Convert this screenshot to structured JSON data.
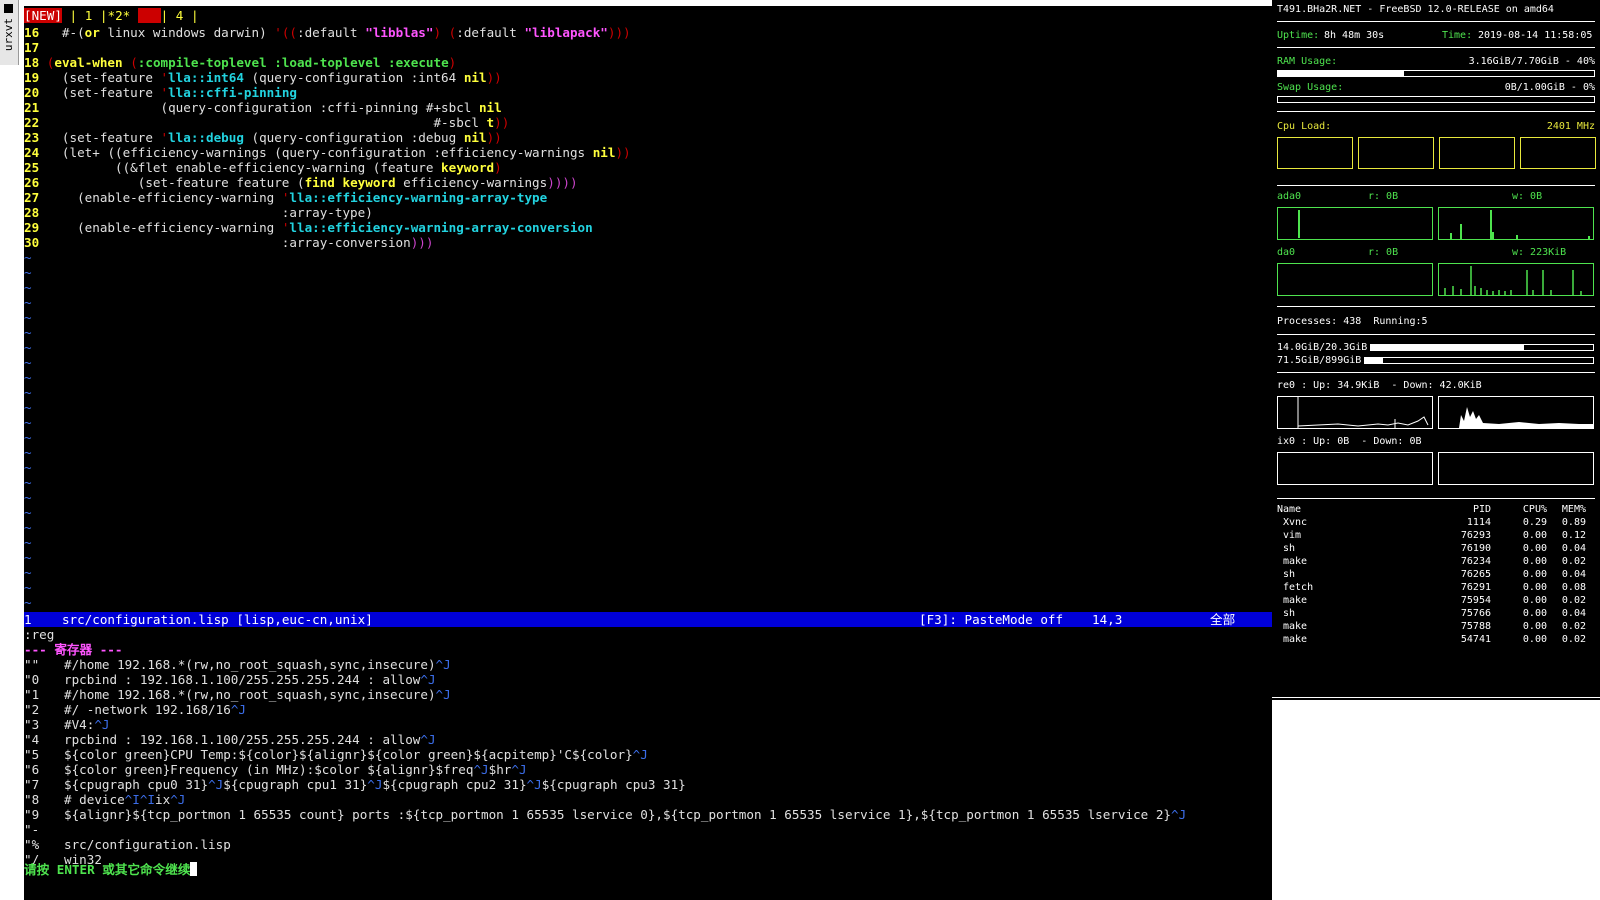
{
  "window": {
    "grip_label": "urxvt"
  },
  "tabs": {
    "new": "[NEW]",
    "t1": "1",
    "t2": "*2*",
    "t3": "3",
    "t4": "4",
    "sep": "|"
  },
  "code": [
    {
      "n": "16"
    },
    {
      "n": "17"
    },
    {
      "n": "18"
    },
    {
      "n": "19"
    },
    {
      "n": "20"
    },
    {
      "n": "21"
    },
    {
      "n": "22"
    },
    {
      "n": "23"
    },
    {
      "n": "24"
    },
    {
      "n": "25"
    },
    {
      "n": "26"
    },
    {
      "n": "27"
    },
    {
      "n": "28"
    },
    {
      "n": "29"
    },
    {
      "n": "30"
    }
  ],
  "t": {
    "l16a": "#-(",
    "l16b": "or",
    "l16c": " linux windows darwin) ",
    "l16d": "'((",
    "l16e": ":default ",
    "l16f": "\"libblas\"",
    "l16g": ") (",
    "l16h": ":default ",
    "l16i": "\"liblapack\"",
    "l16j": ")))",
    "l18a": "(",
    "l18b": "eval-when",
    "l18c": " (",
    "l18d": ":compile-toplevel :load-toplevel :execute",
    "l18e": ")",
    "l19a": "  (set-feature ",
    "l19b": "'",
    "l19c": "lla::int64",
    "l19d": " (query-configuration :int64 ",
    "l19e": "nil",
    "l19f": "))",
    "l20a": "  (set-feature ",
    "l20b": "'",
    "l20c": "lla::cffi-pinning",
    "l21a": "               (query-configuration :cffi-pinning #+sbcl ",
    "l21b": "nil",
    "l22a": "                                                   #-sbcl ",
    "l22b": "t",
    "l22c": "))",
    "l23a": "  (set-feature ",
    "l23b": "'",
    "l23c": "lla::debug",
    "l23d": " (query-configuration :debug ",
    "l23e": "nil",
    "l23f": "))",
    "l24a": "  (",
    "l24b": "let+",
    "l24c": " ((efficiency-warnings (query-configuration :efficiency-warnings ",
    "l24d": "nil",
    "l24e": "))",
    "l25a": "         ((&flet enable-efficiency-warning (feature ",
    "l25b": "keyword",
    "l25c": ")",
    "l26a": "            (set-feature feature (",
    "l26b": "find",
    "l26c": " ",
    "l26d": "keyword",
    "l26e": " efficiency-warnings",
    "l26f": "))))",
    "l27a": "    (enable-efficiency-warning ",
    "l27b": "'",
    "l27c": "lla::efficiency-warning-array-type",
    "l28a": "                               :array-type)",
    "l29a": "    (enable-efficiency-warning ",
    "l29b": "'",
    "l29c": "lla::efficiency-warning-array-conversion",
    "l30a": "                               :array-conversion",
    "l30b": ")))"
  },
  "tilde": "~",
  "statusline": {
    "buf": "1",
    "file": "src/configuration.lisp [lisp,euc-cn,unix]",
    "paste": "[F3]: PasteMode off",
    "pos": "14,3",
    "all": "全部"
  },
  "cmd": ":reg",
  "reg_header": "--- 寄存器 ---",
  "registers": [
    {
      "name": "\"\"",
      "val": "#/home 192.168.*(rw,no_root_squash,sync,insecure)",
      "ctl": "^J"
    },
    {
      "name": "\"0",
      "val": "rpcbind : 192.168.1.100/255.255.255.244 : allow",
      "ctl": "^J"
    },
    {
      "name": "\"1",
      "val": "#/home 192.168.*(rw,no_root_squash,sync,insecure)",
      "ctl": "^J"
    },
    {
      "name": "\"2",
      "val": "#/ -network 192.168/16",
      "ctl": "^J"
    },
    {
      "name": "\"3",
      "val": "#V4:",
      "ctl": "^J"
    },
    {
      "name": "\"4",
      "val": "rpcbind : 192.168.1.100/255.255.255.244 : allow",
      "ctl": "^J"
    },
    {
      "name": "\"5",
      "val": "${color green}CPU Temp:${color}${alignr}${color green}${acpitemp}'C${color}",
      "ctl": "^J"
    },
    {
      "name": "\"6",
      "val": "${color green}Frequency (in MHz):$color ${alignr}$freq",
      "ctl": "^J",
      "tail": "$hr",
      "ctl2": "^J"
    },
    {
      "name": "\"7",
      "val": "${cpugraph cpu0 31}",
      "ctl": "^J",
      "tail": "${cpugraph cpu1 31}",
      "ctl2": "^J",
      "tail2": "${cpugraph cpu2 31}",
      "ctl3": "^J",
      "tail3": "${cpugraph cpu3 31}"
    },
    {
      "name": "\"8",
      "val": "# device",
      "ctl": "^I^I",
      "tail": "ix",
      "ctl2": "^J"
    },
    {
      "name": "\"9",
      "val": "${alignr}${tcp_portmon 1 65535 count} ports :${tcp_portmon 1 65535 lservice 0},${tcp_portmon 1 65535 lservice 1},${tcp_portmon 1 65535 lservice 2}",
      "ctl": "^J"
    },
    {
      "name": "\"-",
      "val": ""
    },
    {
      "name": "\"%",
      "val": "src/configuration.lisp"
    },
    {
      "name": "\"/",
      "val": "win32"
    }
  ],
  "press_enter": "请按 ENTER 或其它命令继续",
  "conky": {
    "title": "T491.BHa2R.NET - FreeBSD 12.0-RELEASE on amd64",
    "uptime_label": "Uptime:",
    "uptime": "8h 48m 30s",
    "time_label": "Time:",
    "time": "2019-08-14 11:58:05",
    "ram_label": "RAM Usage:",
    "ram": "3.16GiB/7.70GiB - 40%",
    "ram_frac": 0.4,
    "swap_label": "Swap Usage:",
    "swap": "0B/1.00GiB - 0%",
    "swap_frac": 0.0,
    "cpu_label": "Cpu Load:",
    "cpu_freq": "2401 MHz",
    "ada0_label": "ada0",
    "ada0_r": "r: 0B",
    "ada0_w": "w: 0B",
    "da0_label": "da0",
    "da0_r": "r: 0B",
    "da0_w": "w: 223KiB",
    "processes_label": "Processes:",
    "processes": "438",
    "running_label": "Running:",
    "running": "5",
    "fs1": "14.0GiB/20.3GiB",
    "fs1_frac": 0.69,
    "fs2": "71.5GiB/899GiB",
    "fs2_frac": 0.08,
    "re0": "re0 : Up: 34.9KiB  - Down: 42.0KiB",
    "ix0": "ix0 : Up: 0B  - Down: 0B",
    "proc_headers": {
      "name": "Name",
      "pid": "PID",
      "cpu": "CPU%",
      "mem": "MEM%"
    },
    "procs": [
      {
        "name": "Xvnc",
        "pid": "1114",
        "cpu": "0.29",
        "mem": "0.89"
      },
      {
        "name": "vim",
        "pid": "76293",
        "cpu": "0.00",
        "mem": "0.12"
      },
      {
        "name": "sh",
        "pid": "76190",
        "cpu": "0.00",
        "mem": "0.04"
      },
      {
        "name": "make",
        "pid": "76234",
        "cpu": "0.00",
        "mem": "0.02"
      },
      {
        "name": "sh",
        "pid": "76265",
        "cpu": "0.00",
        "mem": "0.04"
      },
      {
        "name": "fetch",
        "pid": "76291",
        "cpu": "0.00",
        "mem": "0.08"
      },
      {
        "name": "make",
        "pid": "75954",
        "cpu": "0.00",
        "mem": "0.02"
      },
      {
        "name": "sh",
        "pid": "75766",
        "cpu": "0.00",
        "mem": "0.04"
      },
      {
        "name": "make",
        "pid": "75788",
        "cpu": "0.00",
        "mem": "0.02"
      },
      {
        "name": "make",
        "pid": "54741",
        "cpu": "0.00",
        "mem": "0.02"
      }
    ],
    "colors": {
      "green": "#4ee34e",
      "yellow": "#e8e83c",
      "white": "#ffffff"
    }
  }
}
